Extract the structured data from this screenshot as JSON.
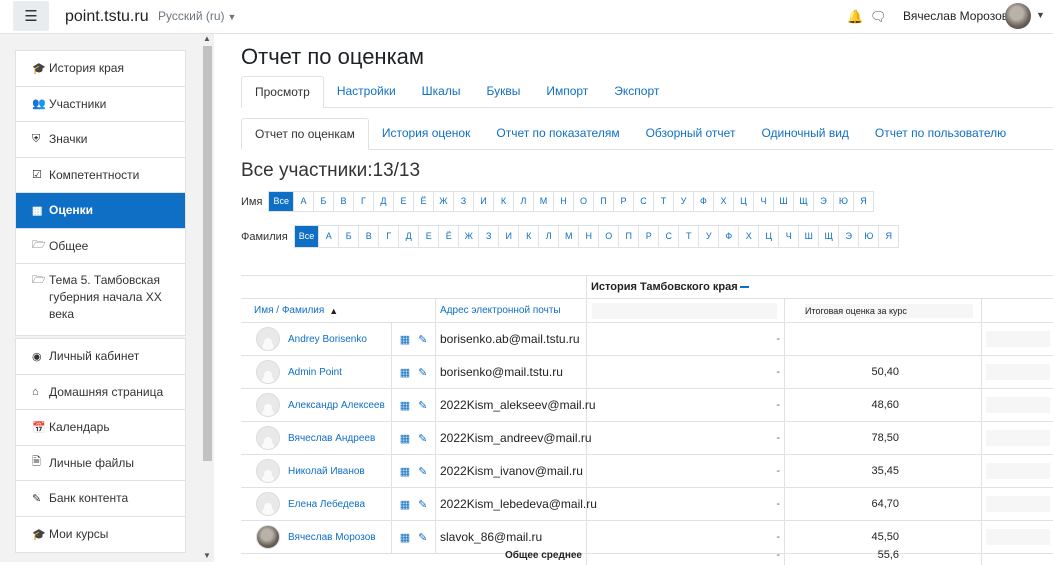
{
  "navbar": {
    "site_name": "point.tstu.ru",
    "language": "Русский (ru)",
    "user_name": "Вячеслав Морозов"
  },
  "sidebar": {
    "course_items": [
      {
        "label": "История края",
        "icon": "graduation-cap-icon",
        "active": false
      },
      {
        "label": "Участники",
        "icon": "users-icon",
        "active": false
      },
      {
        "label": "Значки",
        "icon": "shield-icon",
        "active": false
      },
      {
        "label": "Компетентности",
        "icon": "checkbox-icon",
        "active": false
      },
      {
        "label": "Оценки",
        "icon": "table-icon",
        "active": true
      },
      {
        "label": "Общее",
        "icon": "folder-icon",
        "active": false
      },
      {
        "label": "Тема 5. Тамбовская губерния начала XX века",
        "icon": "folder-icon",
        "active": false
      }
    ],
    "site_items": [
      {
        "label": "Личный кабинет",
        "icon": "dashboard-icon"
      },
      {
        "label": "Домашняя страница",
        "icon": "home-icon"
      },
      {
        "label": "Календарь",
        "icon": "calendar-icon"
      },
      {
        "label": "Личные файлы",
        "icon": "file-icon"
      },
      {
        "label": "Банк контента",
        "icon": "paintbrush-icon"
      },
      {
        "label": "Мои курсы",
        "icon": "graduation-cap-icon"
      }
    ]
  },
  "page": {
    "title": "Отчет по оценкам",
    "tabs_primary": [
      "Просмотр",
      "Настройки",
      "Шкалы",
      "Буквы",
      "Импорт",
      "Экспорт"
    ],
    "tabs_secondary": [
      "Отчет по оценкам",
      "История оценок",
      "Отчет по показателям",
      "Обзорный отчет",
      "Одиночный вид",
      "Отчет по пользователю"
    ],
    "participants": "Все участники:13/13",
    "firstname_label": "Имя",
    "lastname_label": "Фамилия",
    "initials_all": "Все",
    "initials": [
      "А",
      "Б",
      "В",
      "Г",
      "Д",
      "Е",
      "Ё",
      "Ж",
      "З",
      "И",
      "К",
      "Л",
      "М",
      "Н",
      "О",
      "П",
      "Р",
      "С",
      "Т",
      "У",
      "Ф",
      "Х",
      "Ц",
      "Ч",
      "Ш",
      "Щ",
      "Э",
      "Ю",
      "Я"
    ]
  },
  "grades": {
    "category_header": "История Тамбовского края",
    "col_name": "Имя / Фамилия",
    "col_email": "Адрес электронной почты",
    "col_total": "Итоговая оценка за курс",
    "average_label": "Общее среднее",
    "average_cat": "-",
    "average_total": "55,6",
    "rows": [
      {
        "name": "Andrey Borisenko",
        "email": "borisenko.ab@mail.tstu.ru",
        "cat": "-",
        "total": ""
      },
      {
        "name": "Admin Point",
        "email": "borisenko@mail.tstu.ru",
        "cat": "-",
        "total": "50,40"
      },
      {
        "name": "Александр Алексеев",
        "email": "2022Kism_alekseev@mail.ru",
        "cat": "-",
        "total": "48,60"
      },
      {
        "name": "Вячеслав Андреев",
        "email": "2022Kism_andreev@mail.ru",
        "cat": "-",
        "total": "78,50"
      },
      {
        "name": "Николай Иванов",
        "email": "2022Kism_ivanov@mail.ru",
        "cat": "-",
        "total": "35,45"
      },
      {
        "name": "Елена Лебедева",
        "email": "2022Kism_lebedeva@mail.ru",
        "cat": "-",
        "total": "64,70"
      },
      {
        "name": "Вячеслав Морозов",
        "email": "slavok_86@mail.ru",
        "cat": "-",
        "total": "45,50"
      }
    ]
  }
}
